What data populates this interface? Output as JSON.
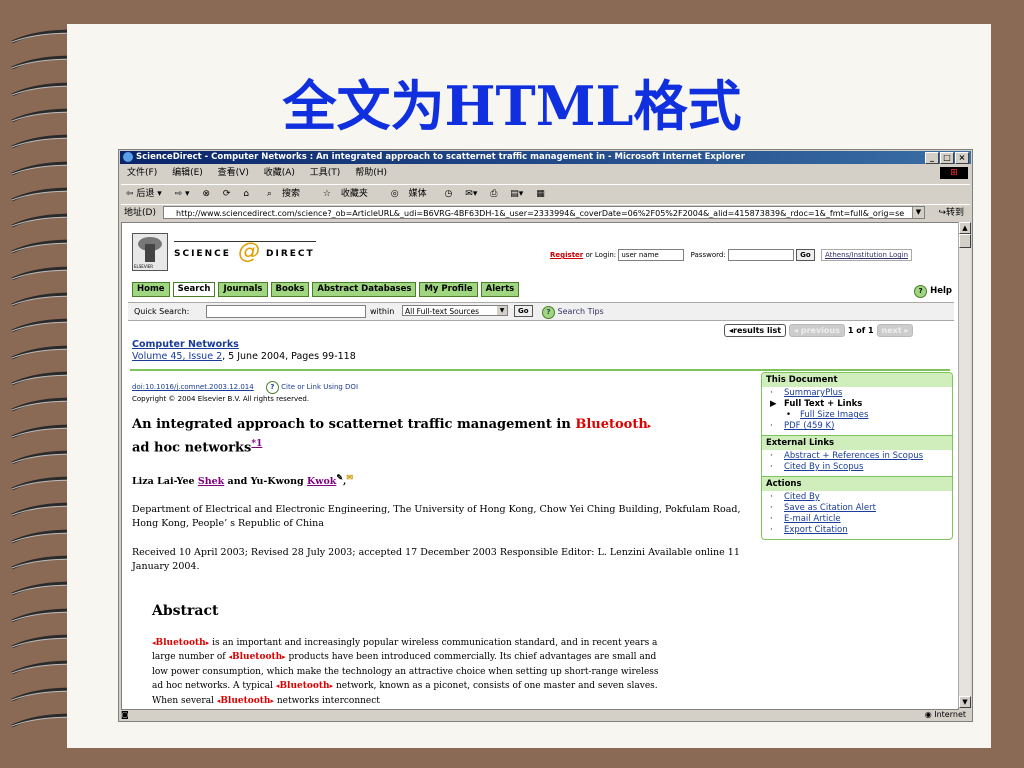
{
  "slide": {
    "title": "全文为HTML格式"
  },
  "window": {
    "title": "ScienceDirect - Computer Networks : An integrated approach to scatternet traffic management in - Microsoft Internet Explorer",
    "controls": [
      "_",
      "□",
      "×"
    ]
  },
  "menu": [
    "文件(F)",
    "编辑(E)",
    "查看(V)",
    "收藏(A)",
    "工具(T)",
    "帮助(H)"
  ],
  "toolbar": {
    "back": "⇦ 后退 ▾",
    "forward": "⇨ ▾",
    "search": "搜索",
    "favorites": "收藏夹",
    "media": "媒体"
  },
  "address": {
    "label": "地址(D)",
    "url": "http://www.sciencedirect.com/science?_ob=ArticleURL&_udi=B6VRG-4BF63DH-1&_user=2333994&_coverDate=06%2F05%2F2004&_alid=415873839&_rdoc=1&_fmt=full&_orig=se",
    "go": "转到"
  },
  "site": {
    "brand_left": "SCIENCE",
    "brand_right": "DIRECT",
    "publisher": "ELSEVIER",
    "register": "Register",
    "or_login": "or Login:",
    "username_value": "user name",
    "password_label": "Password:",
    "go": "Go",
    "athens": "Athens/Institution Login"
  },
  "nav": {
    "items": [
      "Home",
      "Search",
      "Journals",
      "Books",
      "Abstract Databases",
      "My Profile",
      "Alerts"
    ],
    "help": "Help"
  },
  "quick_search": {
    "label": "Quick Search:",
    "within": "within",
    "scope": "All Full-text Sources",
    "go": "Go",
    "tips": "Search Tips"
  },
  "pager": {
    "results": "results list",
    "previous": "previous",
    "count": "1 of 1",
    "next": "next"
  },
  "journal": {
    "name": "Computer Networks",
    "volume": "Volume 45, Issue 2",
    "details": ", 5 June 2004, Pages 99-118"
  },
  "doi": {
    "link": "doi:10.1016/j.comnet.2003.12.014",
    "cite": "Cite or Link Using DOI",
    "copyright": "Copyright © 2004 Elsevier B.V. All rights reserved."
  },
  "article": {
    "title_part1": "An integrated approach to scatternet traffic management in ",
    "title_highlight": "Bluetooth",
    "title_part2": "ad hoc networks",
    "title_ref": "*1",
    "author1_first": "Liza Lai-Yee ",
    "author1_last": "Shek",
    "and": " and Yu-Kwong ",
    "author2_last": "Kwok",
    "affiliation": "Department of Electrical and Electronic Engineering, The University of Hong Kong, Chow Yei Ching Building, Pokfulam Road, Hong Kong, People’ s Republic of China",
    "received": "Received 10 April 2003;  Revised 28 July 2003;  accepted 17 December 2003 Responsible Editor: L. Lenzini  Available online 11 January 2004."
  },
  "abstract": {
    "heading": "Abstract",
    "bt": "Bluetooth",
    "t1": " is an important and increasingly popular wireless communication standard, and in recent years a large number of ",
    "t2": " products have been introduced commercially. Its chief advantages are small and low power consumption, which make the technology an attractive choice when setting up short-range wireless ad hoc networks. A typical ",
    "t3": " network, known as a piconet, consists of one master and seven slaves. When several ",
    "t4": " networks interconnect"
  },
  "sidebar": {
    "this_document": "This Document",
    "doc_items": [
      "SummaryPlus",
      "Full Text + Links",
      "Full Size Images",
      "PDF (459 K)"
    ],
    "external": "External Links",
    "ext_items": [
      "Abstract + References in Scopus",
      "Cited By in Scopus"
    ],
    "actions": "Actions",
    "action_items": [
      "Cited By",
      "Save as Citation Alert",
      "E-mail Article",
      "Export Citation"
    ]
  },
  "status": {
    "zone": "Internet"
  }
}
